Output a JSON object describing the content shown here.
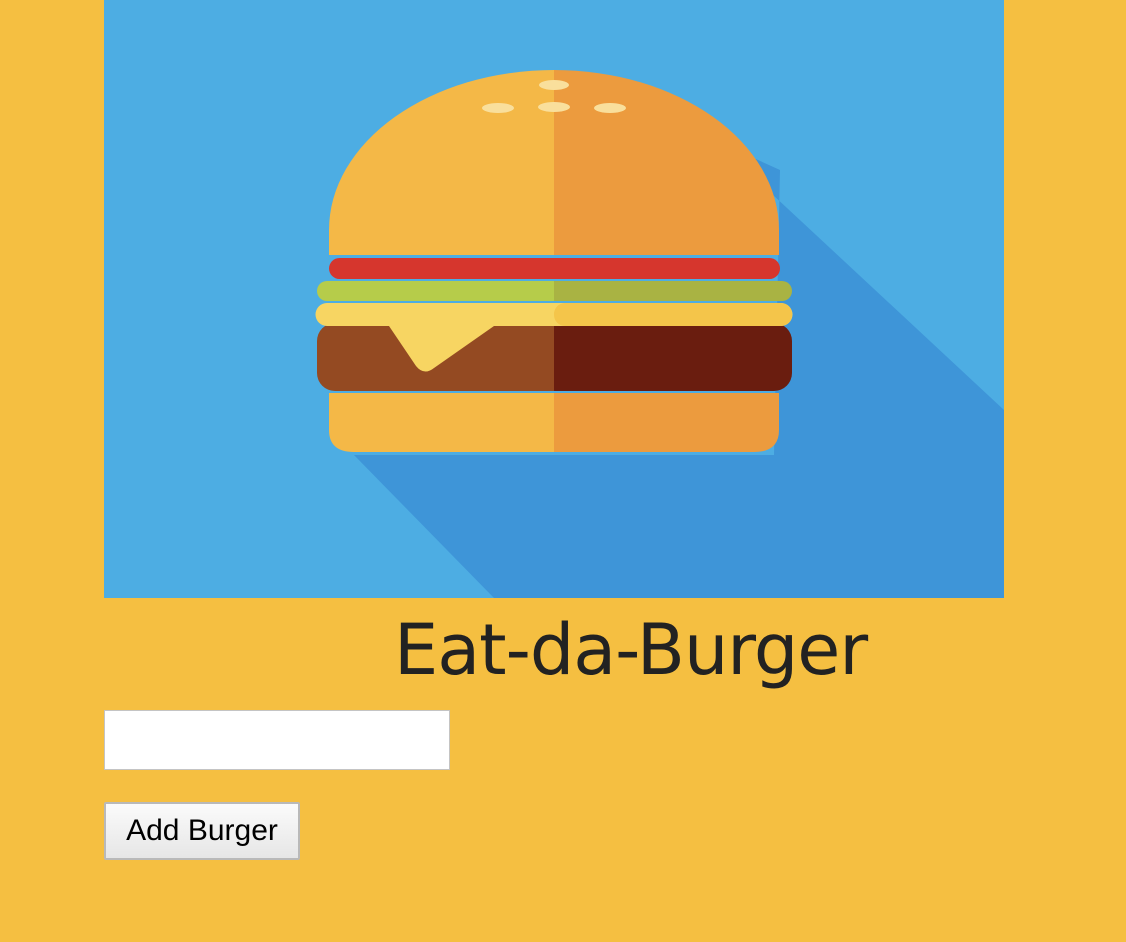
{
  "hero": {
    "image_name": "burger-illustration",
    "colors": {
      "background": "#4dade3",
      "shadow": "#3e95d8",
      "bun_light": "#f4b847",
      "bun_dark": "#ec9b3e",
      "tomato": "#d6362d",
      "lettuce_light": "#b6cc4a",
      "lettuce_dark": "#a9b343",
      "cheese": "#f7d562",
      "patty_light": "#944a22",
      "patty_dark": "#6a1d0f",
      "seed": "#f9df9c"
    }
  },
  "page": {
    "title": "Eat-da-Burger",
    "background": "#f5bf41"
  },
  "form": {
    "input_value": "",
    "input_placeholder": "",
    "submit_label": "Add Burger"
  }
}
